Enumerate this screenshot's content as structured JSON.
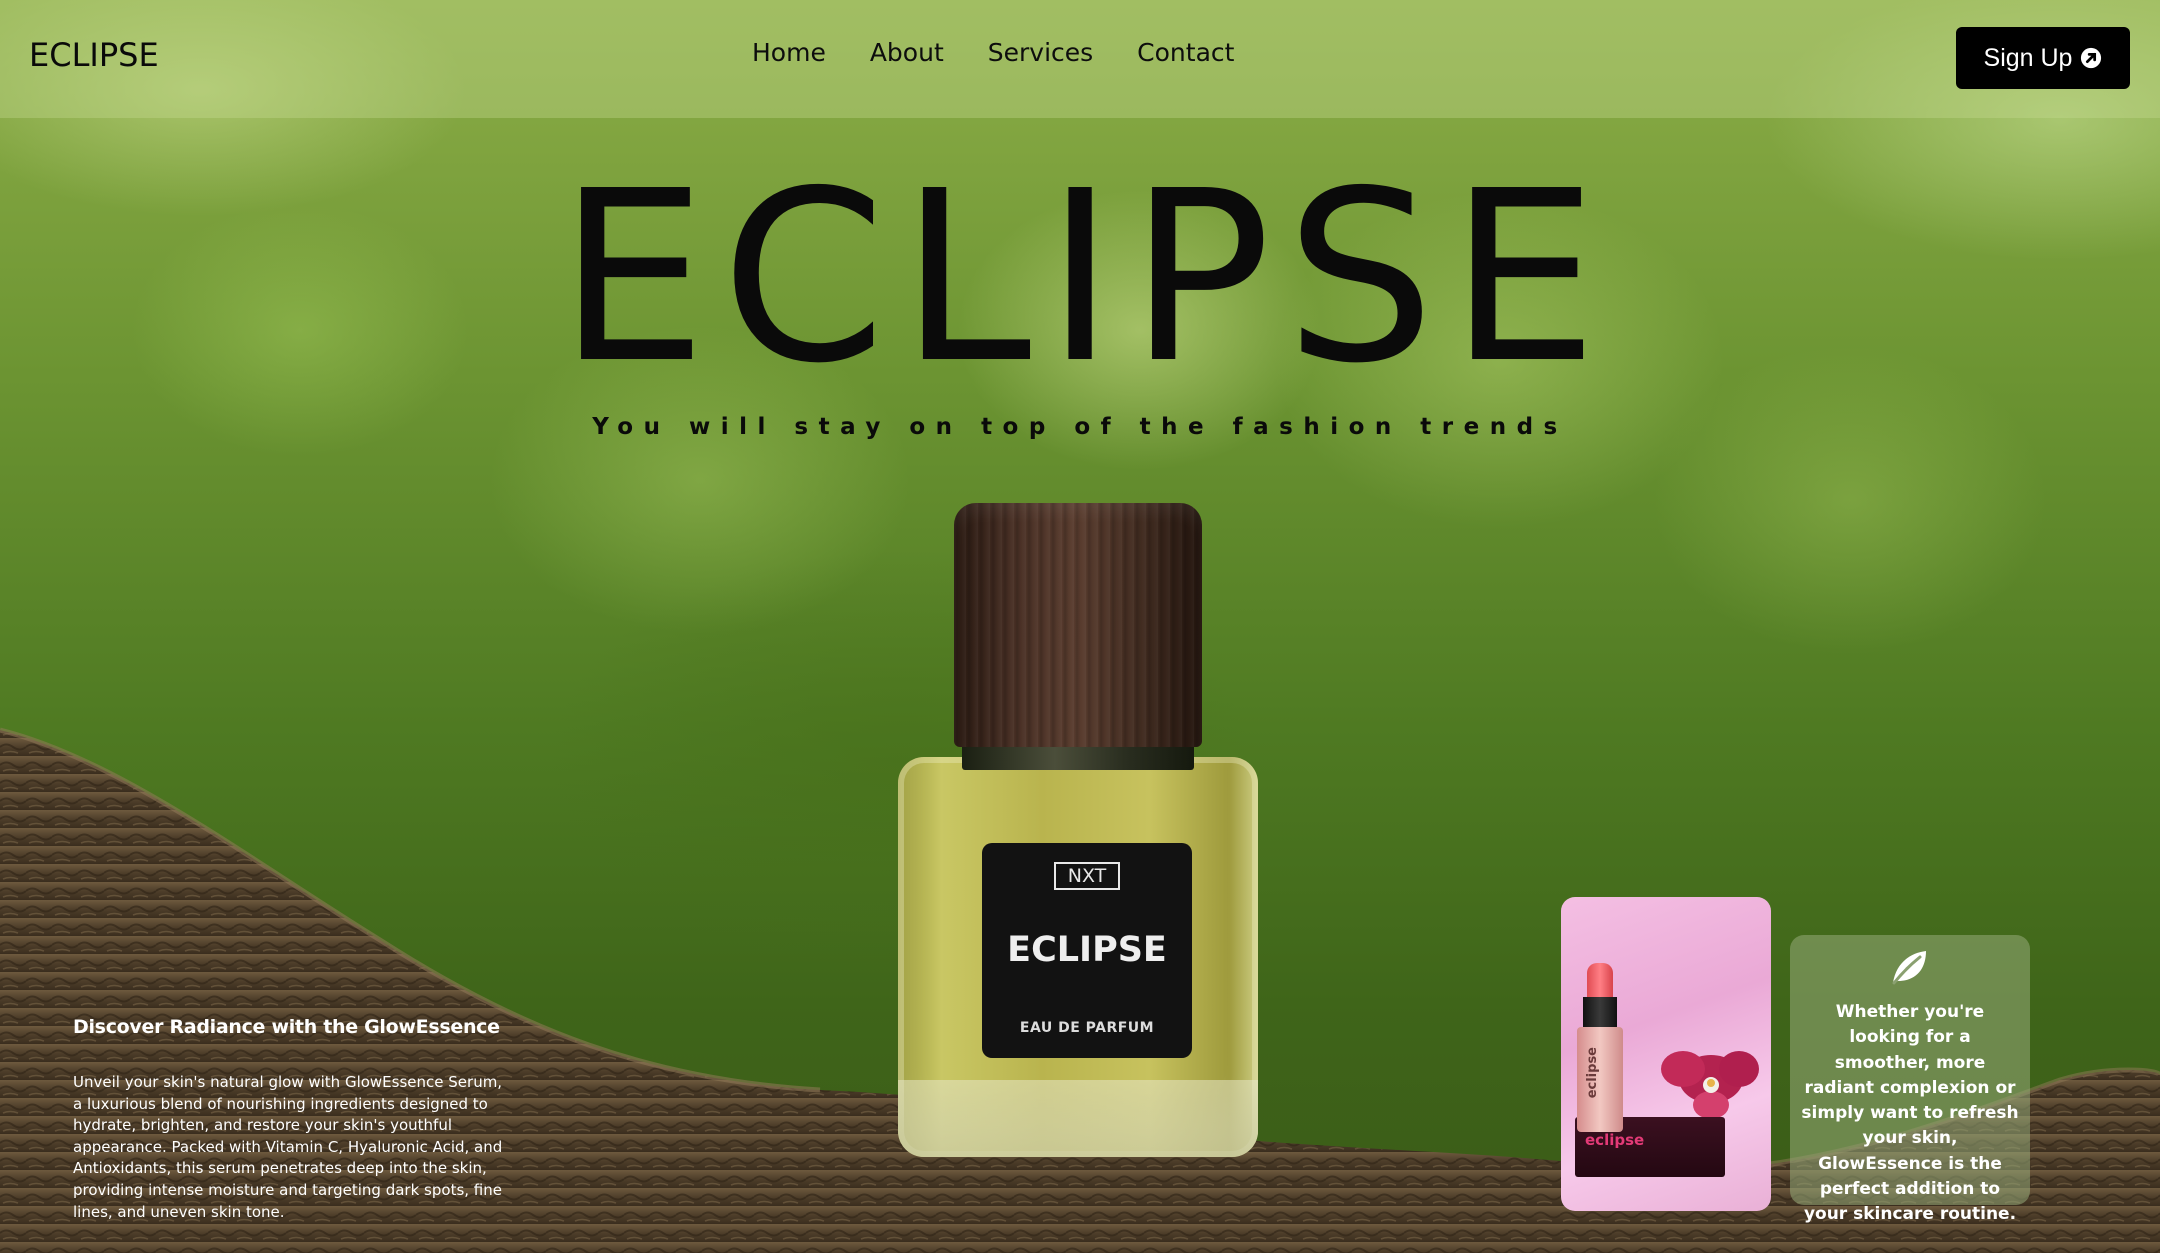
{
  "brand": {
    "logo": "ECLIPSE",
    "logo_icon": "none"
  },
  "nav": {
    "links": [
      {
        "label": "Home"
      },
      {
        "label": "About"
      },
      {
        "label": "Services"
      },
      {
        "label": "Contact"
      }
    ],
    "signup_label": "Sign Up",
    "signup_icon": "arrow-up-right-icon"
  },
  "hero": {
    "title": "ECLIPSE",
    "tagline": "You will stay on top of the fashion trends"
  },
  "product": {
    "label_logo": "NXT",
    "label_brand": "ECLIPSE",
    "label_sub": "EAU DE PARFUM"
  },
  "feature": {
    "title": "Discover Radiance with the GlowEssence",
    "body": "Unveil your skin's natural glow with GlowEssence Serum, a luxurious blend of nourishing ingredients designed to hydrate, brighten, and restore your skin's youthful appearance. Packed with Vitamin C, Hyaluronic Acid, and Antioxidants, this serum penetrates deep into the skin, providing intense moisture and targeting dark spots, fine lines, and uneven skin tone."
  },
  "card": {
    "product_brand": "eclipse",
    "icon": "leaf-icon",
    "text": "Whether you're looking for a smoother, more radiant complexion or simply want to refresh your skin, GlowEssence is the perfect addition to your skincare routine."
  },
  "colors": {
    "text_dark": "#0a0a0a",
    "button_bg": "#000000",
    "card_pink": "#f4bfe3",
    "foliage": "#4f7a22"
  }
}
